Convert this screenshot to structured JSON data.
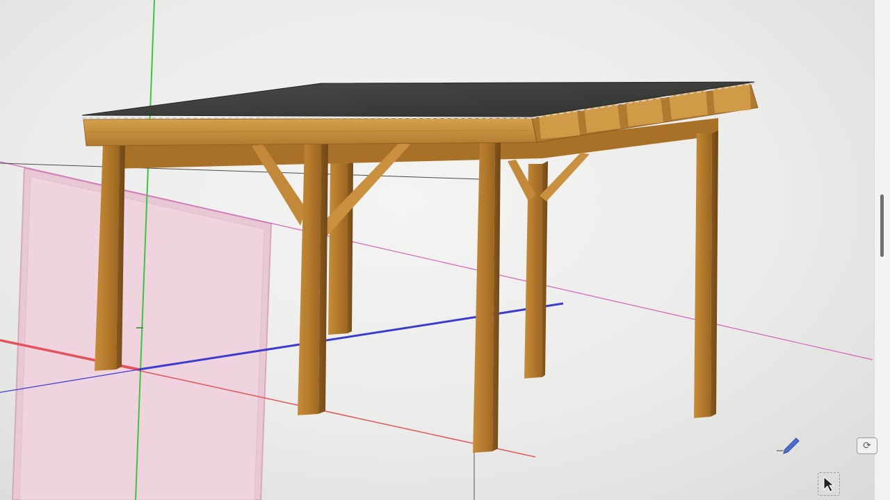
{
  "app": {
    "window_title": ""
  },
  "viewport": {
    "background": "#ececea",
    "axis_colors": {
      "green": "#38c640",
      "red": "#e4525a",
      "blue": "#3b3bd0",
      "magenta": "#d55fb7"
    }
  },
  "model": {
    "description_visible": false,
    "timber_color": "#b8812f",
    "roof_color": "#3b3d3b"
  },
  "tools": {
    "pencil": {
      "icon": "pencil-icon"
    },
    "sync": {
      "icon": "sync-icon",
      "glyph": "⟳"
    },
    "select": {
      "icon": "cursor-icon"
    }
  }
}
